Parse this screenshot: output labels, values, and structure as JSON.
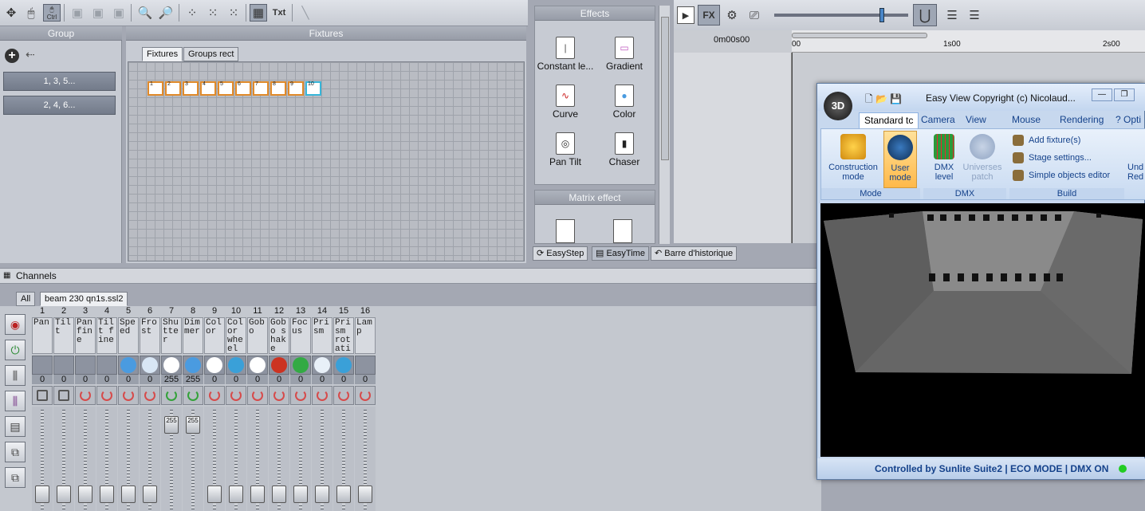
{
  "toolbar": {
    "tools": [
      "move-icon",
      "mouse-icon",
      "ctrl-mouse-icon",
      "add-fixture-icon",
      "add-fixture-2-icon",
      "add-fixture-3-icon",
      "zoom-out-icon",
      "zoom-in-icon",
      "dots-1-icon",
      "dots-2-icon",
      "dots-3-icon",
      "grid-icon",
      "text-icon",
      "line-icon"
    ],
    "ctrl_label": "Ctrl",
    "txt_label": "Txt"
  },
  "group_panel": {
    "title": "Group",
    "groups": [
      "1, 3, 5...",
      "2, 4, 6..."
    ]
  },
  "fixtures_panel": {
    "title": "Fixtures",
    "tabs": [
      "Fixtures",
      "Groups rect"
    ],
    "fixtures": [
      "1",
      "2",
      "3",
      "4",
      "5",
      "6",
      "7",
      "8",
      "9",
      "10"
    ]
  },
  "effects_panel": {
    "title": "Effects",
    "items": [
      {
        "label": "Constant le...",
        "icon": "|"
      },
      {
        "label": "Gradient",
        "icon": "▭"
      },
      {
        "label": "Curve",
        "icon": "∿"
      },
      {
        "label": "Color",
        "icon": "●"
      },
      {
        "label": "Pan Tilt",
        "icon": "◎"
      },
      {
        "label": "Chaser",
        "icon": "▮"
      }
    ]
  },
  "matrix_panel": {
    "title": "Matrix effect"
  },
  "bottom_tabs": [
    "EasyStep",
    "EasyTime",
    "Barre d'historique"
  ],
  "timeline": {
    "time_start": "0m00s00",
    "ticks": [
      "00",
      "1s00",
      "2s00"
    ],
    "fx_label": "FX"
  },
  "channels": {
    "title": "Channels",
    "tabs": [
      "All",
      "beam 230 qn1s.ssl2"
    ],
    "list": [
      {
        "num": "1",
        "name": "Pan",
        "value": "0",
        "icon": "",
        "knob": "lock"
      },
      {
        "num": "2",
        "name": "Tilt",
        "value": "0",
        "icon": "",
        "knob": "lock"
      },
      {
        "num": "3",
        "name": "Pan fine",
        "value": "0",
        "icon": "",
        "knob": "red"
      },
      {
        "num": "4",
        "name": "Tilt fine",
        "value": "0",
        "icon": "",
        "knob": "red"
      },
      {
        "num": "5",
        "name": "Speed",
        "value": "0",
        "icon": "#4a9be0",
        "knob": "red"
      },
      {
        "num": "6",
        "name": "Frost",
        "value": "0",
        "icon": "#d8e6f5",
        "knob": "red"
      },
      {
        "num": "7",
        "name": "Shutter",
        "value": "255",
        "icon": "#ffffff",
        "knob": "green"
      },
      {
        "num": "8",
        "name": "Dimmer",
        "value": "255",
        "icon": "#4a9be0",
        "knob": "green"
      },
      {
        "num": "9",
        "name": "Color",
        "value": "0",
        "icon": "#ffffff",
        "knob": "red"
      },
      {
        "num": "10",
        "name": "Color wheel",
        "value": "0",
        "icon": "#3aa0d8",
        "knob": "red"
      },
      {
        "num": "11",
        "name": "Gobo",
        "value": "0",
        "icon": "#ffffff",
        "knob": "red"
      },
      {
        "num": "12",
        "name": "Gobo shake",
        "value": "0",
        "icon": "#cc3322",
        "knob": "red"
      },
      {
        "num": "13",
        "name": "Focus",
        "value": "0",
        "icon": "#33aa44",
        "knob": "red"
      },
      {
        "num": "14",
        "name": "Prism",
        "value": "0",
        "icon": "#e8f0f8",
        "knob": "red"
      },
      {
        "num": "15",
        "name": "Prism rotati",
        "value": "0",
        "icon": "#3aa0d8",
        "knob": "red"
      },
      {
        "num": "16",
        "name": "Lamp",
        "value": "0",
        "icon": "",
        "knob": "red"
      }
    ],
    "fader_levels": [
      0,
      0,
      0,
      0,
      0,
      0,
      1,
      1,
      0,
      0,
      0,
      0,
      0,
      0,
      0,
      0
    ],
    "fader_cap_labels": [
      "",
      "",
      "",
      "",
      "",
      "",
      "255",
      "255",
      "",
      "",
      "",
      "",
      "",
      "",
      "",
      ""
    ]
  },
  "easyview": {
    "title": "Easy View   Copyright (c) Nicolaud...",
    "tabs": [
      "Standard tc",
      "Camera",
      "View",
      "Mouse",
      "Rendering",
      "? Opti"
    ],
    "mode_group": {
      "label": "Mode",
      "buttons": [
        "Construction mode",
        "User mode"
      ]
    },
    "dmx_group": {
      "label": "DMX",
      "buttons": [
        "DMX level",
        "Universes patch"
      ]
    },
    "build_group": {
      "label": "Build",
      "items": [
        "Add fixture(s)",
        "Stage settings...",
        "Simple objects editor"
      ]
    },
    "undo_label": "Und Red",
    "status": "Controlled by Sunlite Suite2  |  ECO MODE  |  DMX ON"
  }
}
